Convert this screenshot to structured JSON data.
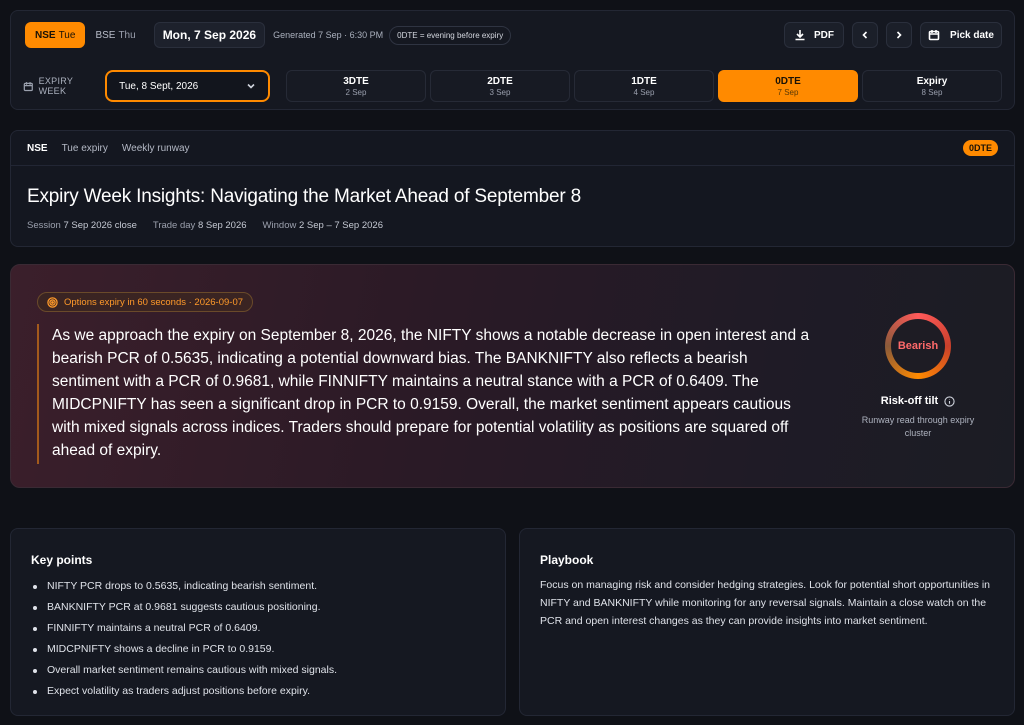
{
  "topbar": {
    "exchanges": [
      {
        "name": "NSE",
        "day": "Tue",
        "active": true
      },
      {
        "name": "BSE",
        "day": "Thu",
        "active": false
      }
    ],
    "current_date": "Mon, 7 Sep 2026",
    "generated": "Generated 7 Sep · 6:30 PM",
    "badge_0dte": "0DTE = evening before expiry",
    "pdf_label": "PDF",
    "pick_date_label": "Pick date"
  },
  "expiry": {
    "label": "EXPIRY WEEK",
    "selected": "Tue, 8 Sept, 2026",
    "tabs": [
      {
        "label": "3DTE",
        "date": "2 Sep",
        "active": false
      },
      {
        "label": "2DTE",
        "date": "3 Sep",
        "active": false
      },
      {
        "label": "1DTE",
        "date": "4 Sep",
        "active": false
      },
      {
        "label": "0DTE",
        "date": "7 Sep",
        "active": true
      },
      {
        "label": "Expiry",
        "date": "8 Sep",
        "active": false
      }
    ]
  },
  "header": {
    "crumbs": [
      "NSE",
      "Tue expiry",
      "Weekly runway"
    ],
    "tag": "0DTE",
    "title": "Expiry Week Insights: Navigating the Market Ahead of September 8",
    "meta": [
      {
        "k": "Session",
        "v": "7 Sep 2026 close"
      },
      {
        "k": "Trade day",
        "v": "8 Sep 2026"
      },
      {
        "k": "Window",
        "v": "2 Sep – 7 Sep 2026"
      }
    ]
  },
  "insight": {
    "countdown": "Options expiry in 60 seconds · 2026-09-07",
    "summary": "As we approach the expiry on September 8, 2026, the NIFTY shows a notable decrease in open interest and a bearish PCR of 0.5635, indicating a potential downward bias. The BANKNIFTY also reflects a bearish sentiment with a PCR of 0.9681, while FINNIFTY maintains a neutral stance with a PCR of 0.6409. The MIDCPNIFTY has seen a significant drop in PCR to 0.9159. Overall, the market sentiment appears cautious with mixed signals across indices. Traders should prepare for potential volatility as positions are squared off ahead of expiry.",
    "gauge_label": "Bearish",
    "tilt": "Risk-off tilt",
    "tilt_sub": "Runway read through expiry cluster",
    "colors": {
      "accent": "#ff8a00",
      "bearish": "#ff6a6a"
    }
  },
  "key_points": {
    "title": "Key points",
    "items": [
      "NIFTY PCR drops to 0.5635, indicating bearish sentiment.",
      "BANKNIFTY PCR at 0.9681 suggests cautious positioning.",
      "FINNIFTY maintains a neutral PCR of 0.6409.",
      "MIDCPNIFTY shows a decline in PCR to 0.9159.",
      "Overall market sentiment remains cautious with mixed signals.",
      "Expect volatility as traders adjust positions before expiry."
    ]
  },
  "playbook": {
    "title": "Playbook",
    "text": "Focus on managing risk and consider hedging strategies. Look for potential short opportunities in NIFTY and BANKNIFTY while monitoring for any reversal signals. Maintain a close watch on the PCR and open interest changes as they can provide insights into market sentiment."
  }
}
